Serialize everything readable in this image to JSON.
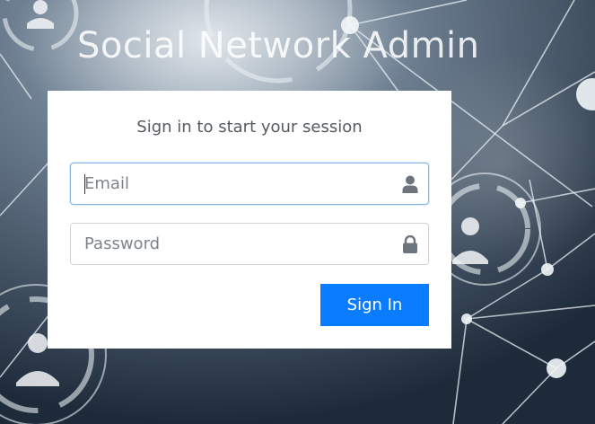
{
  "app": {
    "title": "Social Network Admin"
  },
  "login": {
    "message": "Sign in to start your session",
    "email": {
      "placeholder": "Email",
      "value": "",
      "icon": "user-icon",
      "focused": true
    },
    "password": {
      "placeholder": "Password",
      "value": "",
      "icon": "lock-icon"
    },
    "submit_label": "Sign In"
  },
  "colors": {
    "primary": "#0a7cff",
    "background": "#243345",
    "box": "#ffffff",
    "icon": "#6c757d"
  }
}
